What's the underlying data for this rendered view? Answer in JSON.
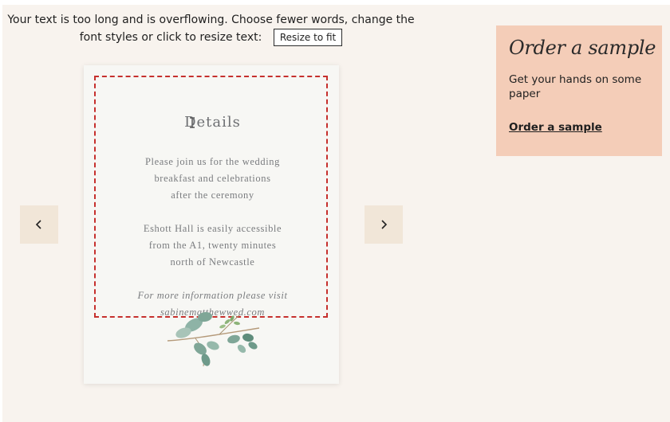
{
  "warning": {
    "message": "Your text is too long and is overflowing. Choose fewer words, change the font styles or click to resize text:",
    "resize_button": "Resize to fit"
  },
  "card": {
    "title": "Details",
    "paragraphs": [
      {
        "lines": [
          "Please join us for the wedding",
          "breakfast and celebrations",
          "after the ceremony"
        ]
      },
      {
        "lines": [
          "Eshott Hall is easily accessible",
          "from the A1, twenty minutes",
          "north of Newcastle"
        ]
      },
      {
        "lines": [
          "For more information please visit",
          "sabinematthewwed.com"
        ]
      }
    ],
    "frame_color": "#c6302d"
  },
  "nav": {
    "prev_icon": "chevron-left-icon",
    "next_icon": "chevron-right-icon"
  },
  "sample": {
    "title": "Order a sample",
    "description": "Get your hands on some paper",
    "link": "Order a sample",
    "background": "#f4cdb8"
  },
  "colors": {
    "page_background": "#f8f3ee",
    "nav_background": "#f1e6d8"
  }
}
